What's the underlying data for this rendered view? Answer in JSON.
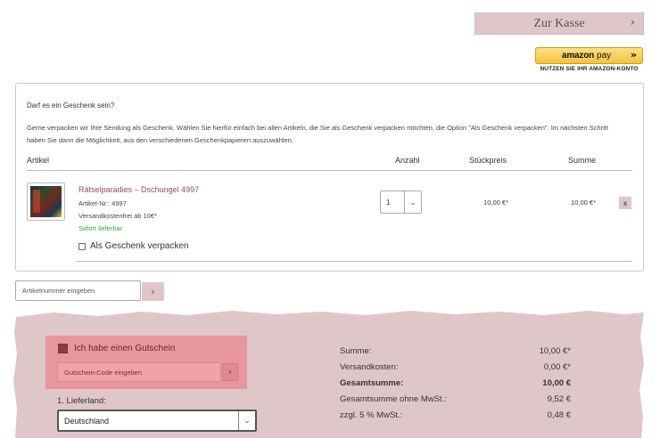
{
  "header": {
    "checkout_label": "Zur Kasse",
    "checkout_icon": "chevron-right-icon",
    "amazon_pay": {
      "logo_text": "amazon",
      "pay_text": "pay",
      "subtitle": "NUTZEN SIE IHR AMAZON-KONTO",
      "color": "#f4c33a"
    }
  },
  "cart": {
    "gift_title": "Darf es ein Geschenk sein?",
    "gift_text": "Gerne verpacken wir Ihre Sendung als Geschenk. Wählen Sie hierfür einfach bei allen Artikeln, die Sie als Geschenk verpacken möchten, die Option \"Als Geschenk verpacken\". Im nächsten Schritt haben Sie dann die Möglichkeit, aus den verschiedenen Geschenkpapieren auszuwählen.",
    "columns": {
      "artikel": "Artikel",
      "anzahl": "Anzahl",
      "stueckpreis": "Stückpreis",
      "summe": "Summe"
    },
    "item": {
      "name": "Rätselparadies – Dschungel 4997",
      "article_no": "Artikel-Nr.: 4997",
      "shipping_note": "Versandkostenfrei ab 10€*",
      "availability": "Sofort lieferbar",
      "quantity": "1",
      "unit_price": "10,00 €*",
      "total_price": "10,00 €*",
      "gift_option_label": "Als Geschenk verpacken",
      "gift_option_checked": false,
      "remove_label": "x"
    },
    "availability_color": "#2eaa3c",
    "product_name_color": "#9a4a52"
  },
  "article_entry": {
    "placeholder": "Artikelnummer eingeben",
    "button_icon": "chevron-right-icon"
  },
  "voucher": {
    "label": "Ich habe einen Gutschein",
    "placeholder": "Gutschein-Code eingeben",
    "checked": true,
    "background_color": "#e8969c"
  },
  "shipping": {
    "country_label": "1. Lieferland:",
    "country_value": "Deutschland"
  },
  "totals": [
    {
      "label": "Summe:",
      "value": "10,00 €*",
      "bold": false
    },
    {
      "label": "Versandkosten:",
      "value": "0,00 €*",
      "bold": false
    },
    {
      "label": "Gesamtsumme:",
      "value": "10,00 €",
      "bold": true
    },
    {
      "label": "Gesamtsumme ohne MwSt.:",
      "value": "9,52 €",
      "bold": false
    },
    {
      "label": "zzgl. 5 % MwSt.:",
      "value": "0,48 €",
      "bold": false
    }
  ],
  "colors": {
    "accent_button": "#dfc7c9",
    "summary_background": "#dfc7c9"
  }
}
